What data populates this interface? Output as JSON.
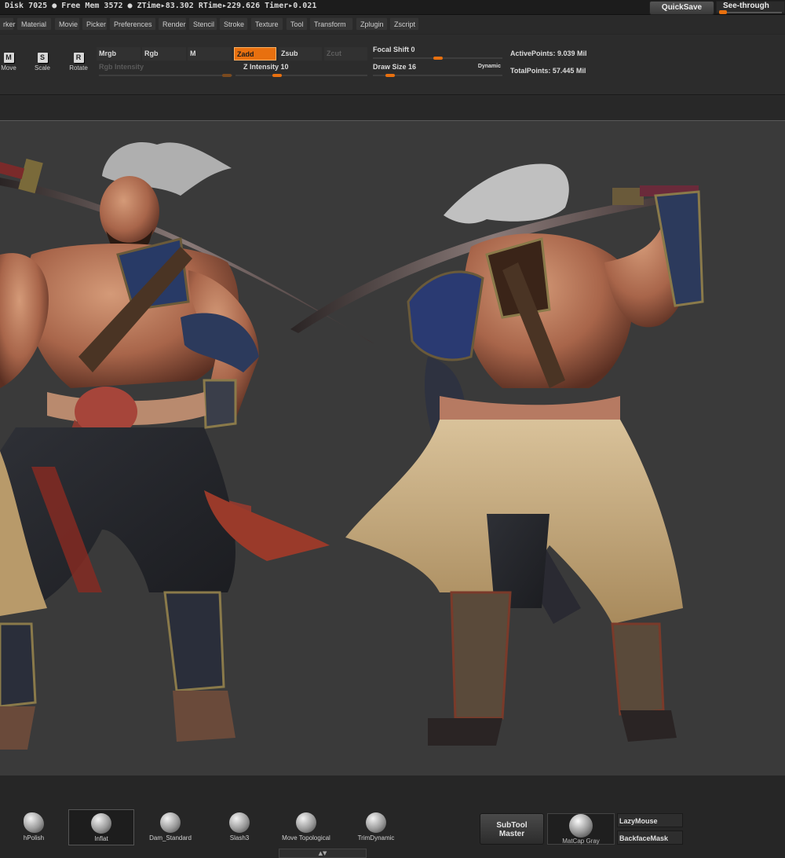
{
  "status_bar": {
    "text": "Disk 7025 ● Free Mem 3572 ● ZTime▸83.302 RTime▸229.626 Timer▸0.021"
  },
  "quicksave": "QuickSave",
  "see_through": "See-through",
  "menu": [
    "rker",
    "Material",
    "Movie",
    "Picker",
    "Preferences",
    "Render",
    "Stencil",
    "Stroke",
    "Texture",
    "Tool",
    "Transform",
    "Zplugin",
    "Zscript"
  ],
  "transform_tools": [
    {
      "icon": "M",
      "label": "Move"
    },
    {
      "icon": "S",
      "label": "Scale"
    },
    {
      "icon": "R",
      "label": "Rotate"
    }
  ],
  "modes": {
    "mrgb": "Mrgb",
    "rgb": "Rgb",
    "m": "M",
    "zadd": "Zadd",
    "zsub": "Zsub",
    "zcut": "Zcut"
  },
  "rgb_intensity": "Rgb Intensity",
  "z_intensity": "Z Intensity 10",
  "focal_shift": "Focal Shift 0",
  "draw_size": "Draw Size 16",
  "dynamic": "Dynamic",
  "active_points": "ActivePoints: 9.039 Mil",
  "total_points": "TotalPoints: 57.445 Mil",
  "brushes": [
    "hPolish",
    "Inflat",
    "Dam_Standard",
    "Slash3",
    "Move Topological",
    "TrimDynamic"
  ],
  "subtool_master": {
    "line1": "SubTool",
    "line2": "Master"
  },
  "matcap": "MatCap Gray",
  "lazymouse": "LazyMouse",
  "backfacemask": "BackfaceMask",
  "colors": {
    "accent": "#e8700f",
    "canvas": "#3a3a3a"
  }
}
